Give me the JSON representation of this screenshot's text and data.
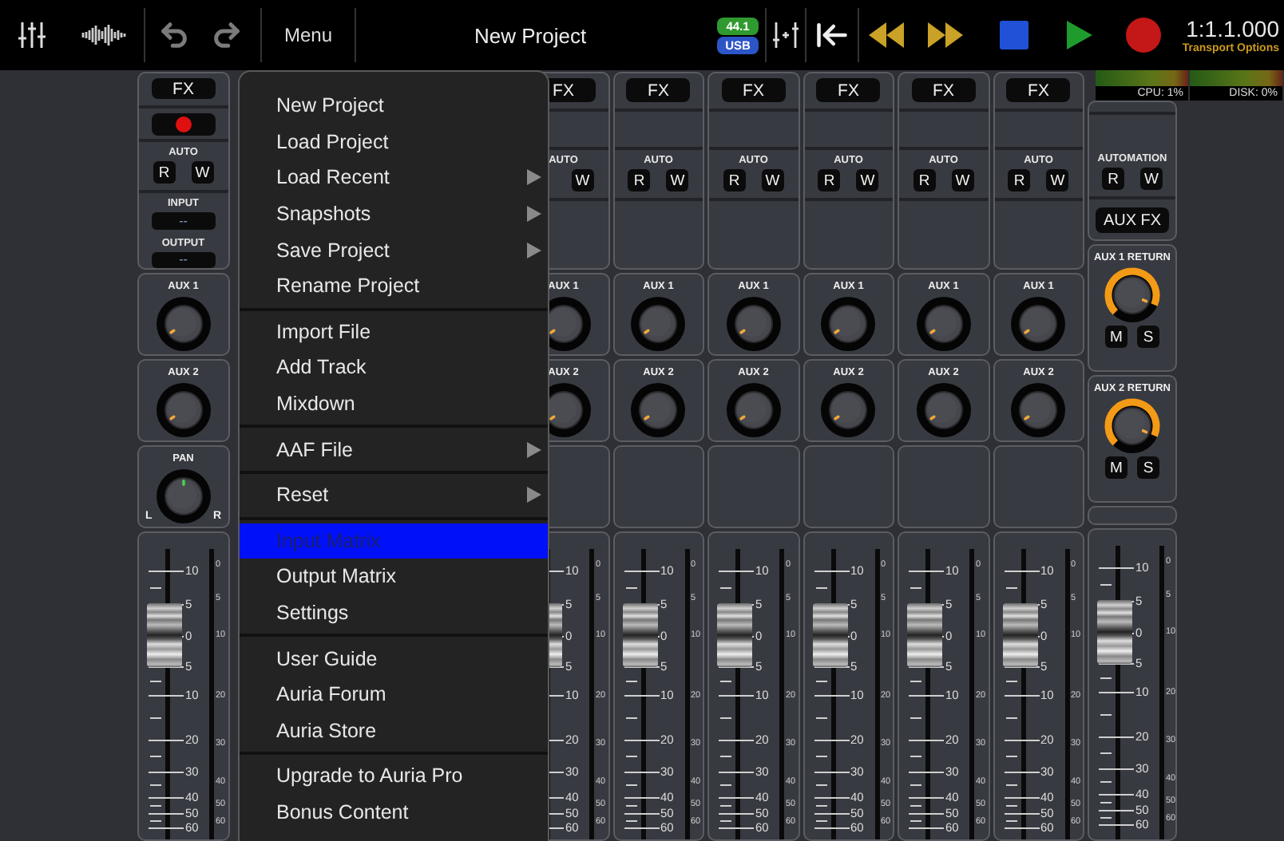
{
  "toolbar": {
    "menu_label": "Menu",
    "title": "New Project",
    "sample_rate": "44.1",
    "interface": "USB",
    "time": "1:1.1.000",
    "transport_options": "Transport Options"
  },
  "meters": [
    {
      "label": "CPU: 1%"
    },
    {
      "label": "DISK: 0%"
    }
  ],
  "channels": [
    {
      "fx": "FX",
      "record_button": true,
      "auto": "AUTO",
      "read": "R",
      "write": "W",
      "input_label": "INPUT",
      "input_value": "--",
      "output_label": "OUTPUT",
      "output_value": "--",
      "aux1": {
        "label": "AUX 1",
        "level": 0.04
      },
      "aux2": {
        "label": "AUX 2",
        "level": 0.04
      },
      "pan": {
        "label": "PAN",
        "left": "L",
        "right": "R",
        "level": 0.5
      },
      "fader": {
        "level": 0.69,
        "scale": [
          "10",
          "5",
          "0",
          "5",
          "10",
          "20",
          "30",
          "40",
          "50",
          "60"
        ],
        "meter_scale": [
          "0",
          "5",
          "10",
          "20",
          "30",
          "40",
          "50",
          "60"
        ]
      }
    },
    {
      "fx": "FX",
      "record_button": false,
      "auto": "AUTO",
      "write": "W",
      "aux1": {
        "label": "AUX 1",
        "level": 0.04
      },
      "aux2": {
        "label": "AUX 2",
        "level": 0.04
      },
      "fader": {
        "level": 0.69,
        "scale": [
          "10",
          "5",
          "0",
          "5",
          "10",
          "20",
          "30",
          "40",
          "50",
          "60"
        ],
        "meter_scale": [
          "0",
          "5",
          "10",
          "20",
          "30",
          "40",
          "50",
          "60"
        ]
      }
    },
    {
      "fx": "FX",
      "record_button": false,
      "auto": "AUTO",
      "read": "R",
      "write": "W",
      "aux1": {
        "label": "AUX 1",
        "level": 0.04
      },
      "aux2": {
        "label": "AUX 2",
        "level": 0.04
      },
      "fader": {
        "level": 0.69,
        "scale": [
          "10",
          "5",
          "0",
          "5",
          "10",
          "20",
          "30",
          "40",
          "50",
          "60"
        ],
        "meter_scale": [
          "0",
          "5",
          "10",
          "20",
          "30",
          "40",
          "50",
          "60"
        ]
      }
    },
    {
      "fx": "FX",
      "record_button": false,
      "auto": "AUTO",
      "read": "R",
      "write": "W",
      "aux1": {
        "label": "AUX 1",
        "level": 0.04
      },
      "aux2": {
        "label": "AUX 2",
        "level": 0.04
      },
      "fader": {
        "level": 0.69,
        "scale": [
          "10",
          "5",
          "0",
          "5",
          "10",
          "20",
          "30",
          "40",
          "50",
          "60"
        ],
        "meter_scale": [
          "0",
          "5",
          "10",
          "20",
          "30",
          "40",
          "50",
          "60"
        ]
      }
    },
    {
      "fx": "FX",
      "record_button": false,
      "auto": "AUTO",
      "read": "R",
      "write": "W",
      "aux1": {
        "label": "AUX 1",
        "level": 0.04
      },
      "aux2": {
        "label": "AUX 2",
        "level": 0.04
      },
      "fader": {
        "level": 0.69,
        "scale": [
          "10",
          "5",
          "0",
          "5",
          "10",
          "20",
          "30",
          "40",
          "50",
          "60"
        ],
        "meter_scale": [
          "0",
          "5",
          "10",
          "20",
          "30",
          "40",
          "50",
          "60"
        ]
      }
    },
    {
      "fx": "FX",
      "record_button": false,
      "auto": "AUTO",
      "read": "R",
      "write": "W",
      "aux1": {
        "label": "AUX 1",
        "level": 0.04
      },
      "aux2": {
        "label": "AUX 2",
        "level": 0.04
      },
      "fader": {
        "level": 0.69,
        "scale": [
          "10",
          "5",
          "0",
          "5",
          "10",
          "20",
          "30",
          "40",
          "50",
          "60"
        ],
        "meter_scale": [
          "0",
          "5",
          "10",
          "20",
          "30",
          "40",
          "50",
          "60"
        ]
      }
    },
    {
      "fx": "FX",
      "record_button": false,
      "auto": "AUTO",
      "read": "R",
      "write": "W",
      "aux1": {
        "label": "AUX 1",
        "level": 0.04
      },
      "aux2": {
        "label": "AUX 2",
        "level": 0.04
      },
      "fader": {
        "level": 0.69,
        "scale": [
          "10",
          "5",
          "0",
          "5",
          "10",
          "20",
          "30",
          "40",
          "50",
          "60"
        ],
        "meter_scale": [
          "0",
          "5",
          "10",
          "20",
          "30",
          "40",
          "50",
          "60"
        ]
      }
    }
  ],
  "aux_strip": {
    "automation": "AUTOMATION",
    "read": "R",
    "write": "W",
    "aux_fx": "AUX FX",
    "returns": [
      {
        "label": "AUX 1 RETURN",
        "level": 0.92,
        "mute": "M",
        "solo": "S"
      },
      {
        "label": "AUX 2 RETURN",
        "level": 0.92,
        "mute": "M",
        "solo": "S"
      }
    ],
    "fader": {
      "level": 0.69,
      "scale": [
        "10",
        "5",
        "0",
        "5",
        "10",
        "20",
        "30",
        "40",
        "50",
        "60"
      ],
      "meter_scale": [
        "0",
        "5",
        "10",
        "20",
        "30",
        "40",
        "50",
        "60"
      ]
    }
  },
  "menu": {
    "groups": [
      [
        {
          "label": "New Project",
          "submenu": false,
          "selected": false
        },
        {
          "label": "Load Project",
          "submenu": false,
          "selected": false
        },
        {
          "label": "Load Recent",
          "submenu": true,
          "selected": false
        },
        {
          "label": "Snapshots",
          "submenu": true,
          "selected": false
        },
        {
          "label": "Save Project",
          "submenu": true,
          "selected": false
        },
        {
          "label": "Rename Project",
          "submenu": false,
          "selected": false
        }
      ],
      [
        {
          "label": "Import File",
          "submenu": false,
          "selected": false
        },
        {
          "label": "Add Track",
          "submenu": false,
          "selected": false
        },
        {
          "label": "Mixdown",
          "submenu": false,
          "selected": false
        }
      ],
      [
        {
          "label": "AAF File",
          "submenu": true,
          "selected": false
        }
      ],
      [
        {
          "label": "Reset",
          "submenu": true,
          "selected": false
        }
      ],
      [
        {
          "label": "Input Matrix",
          "submenu": false,
          "selected": true
        },
        {
          "label": "Output Matrix",
          "submenu": false,
          "selected": false
        },
        {
          "label": "Settings",
          "submenu": false,
          "selected": false
        }
      ],
      [
        {
          "label": "User Guide",
          "submenu": false,
          "selected": false
        },
        {
          "label": "Auria Forum",
          "submenu": false,
          "selected": false
        },
        {
          "label": "Auria Store",
          "submenu": false,
          "selected": false
        }
      ],
      [
        {
          "label": "Upgrade to Auria Pro",
          "submenu": false,
          "selected": false
        },
        {
          "label": "Bonus Content",
          "submenu": false,
          "selected": false
        }
      ]
    ]
  }
}
